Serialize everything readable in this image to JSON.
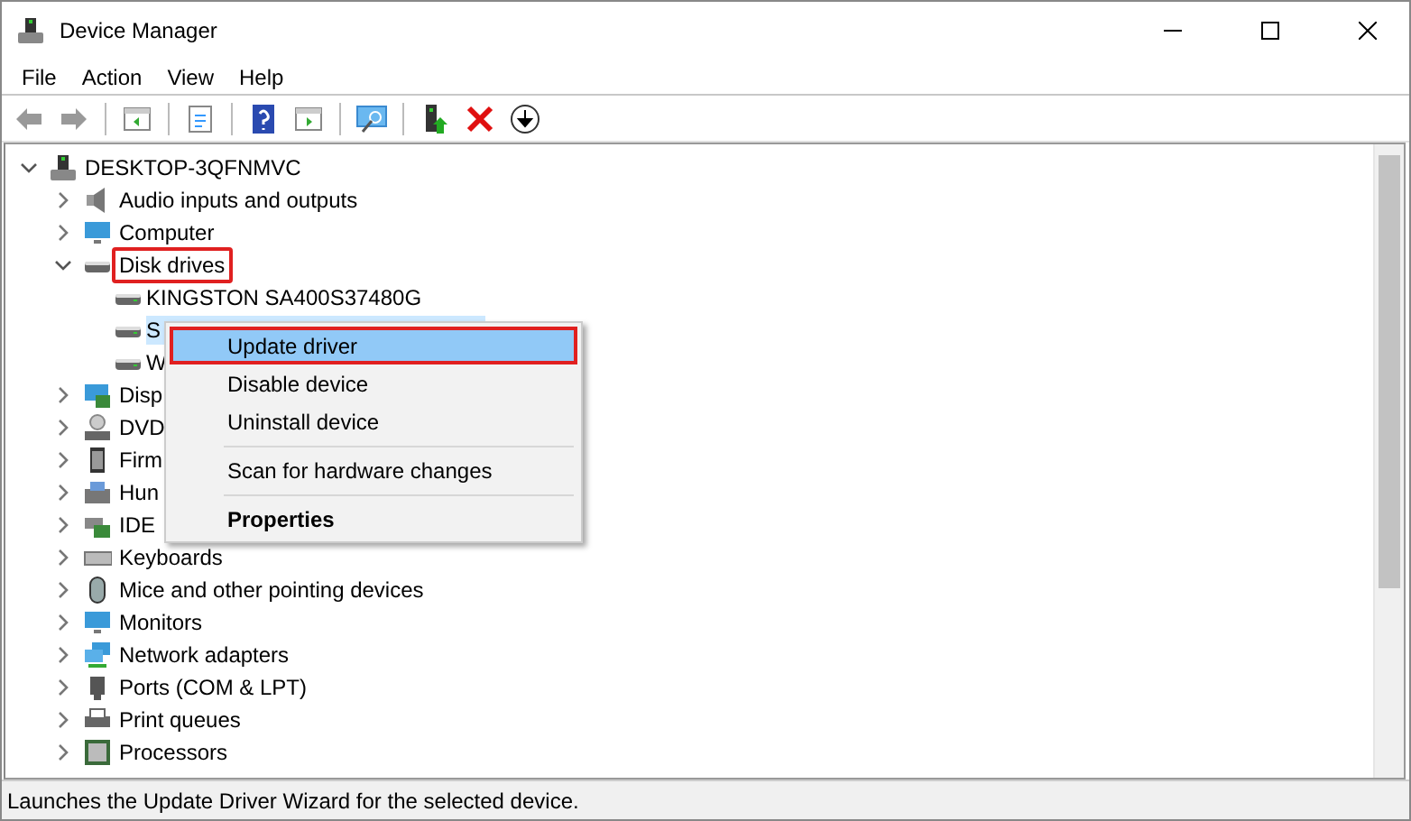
{
  "window": {
    "title": "Device Manager"
  },
  "menu": [
    {
      "label": "File"
    },
    {
      "label": "Action"
    },
    {
      "label": "View"
    },
    {
      "label": "Help"
    }
  ],
  "tree": {
    "label": "DESKTOP-3QFNMVC",
    "expanded": true,
    "children": [
      {
        "label": "Audio inputs and outputs",
        "expanded": false,
        "outlined": false
      },
      {
        "label": "Computer",
        "expanded": false,
        "outlined": false
      },
      {
        "label": "Disk drives",
        "expanded": true,
        "outlined": true,
        "children": [
          {
            "label": "KINGSTON SA400S37480G",
            "selected": false
          },
          {
            "label": "S",
            "selected": true
          },
          {
            "label": "W",
            "selected": false
          }
        ]
      },
      {
        "label": "Disp",
        "expanded": false,
        "outlined": false
      },
      {
        "label": "DVD",
        "expanded": false,
        "outlined": false
      },
      {
        "label": "Firm",
        "expanded": false,
        "outlined": false
      },
      {
        "label": "Hun",
        "expanded": false,
        "outlined": false
      },
      {
        "label": "IDE",
        "expanded": false,
        "outlined": false
      },
      {
        "label": "Keyboards",
        "expanded": false,
        "outlined": false
      },
      {
        "label": "Mice and other pointing devices",
        "expanded": false,
        "outlined": false
      },
      {
        "label": "Monitors",
        "expanded": false,
        "outlined": false
      },
      {
        "label": "Network adapters",
        "expanded": false,
        "outlined": false
      },
      {
        "label": "Ports (COM & LPT)",
        "expanded": false,
        "outlined": false
      },
      {
        "label": "Print queues",
        "expanded": false,
        "outlined": false
      },
      {
        "label": "Processors",
        "expanded": false,
        "outlined": false
      }
    ]
  },
  "context_menu": [
    {
      "kind": "item",
      "label": "Update driver",
      "selected": true,
      "outlined": true,
      "bold": false
    },
    {
      "kind": "item",
      "label": "Disable device",
      "selected": false,
      "outlined": false,
      "bold": false
    },
    {
      "kind": "item",
      "label": "Uninstall device",
      "selected": false,
      "outlined": false,
      "bold": false
    },
    {
      "kind": "separator"
    },
    {
      "kind": "item",
      "label": "Scan for hardware changes",
      "selected": false,
      "outlined": false,
      "bold": false
    },
    {
      "kind": "separator"
    },
    {
      "kind": "item",
      "label": "Properties",
      "selected": false,
      "outlined": false,
      "bold": true
    }
  ],
  "status_bar": {
    "text": "Launches the Update Driver Wizard for the selected device."
  }
}
